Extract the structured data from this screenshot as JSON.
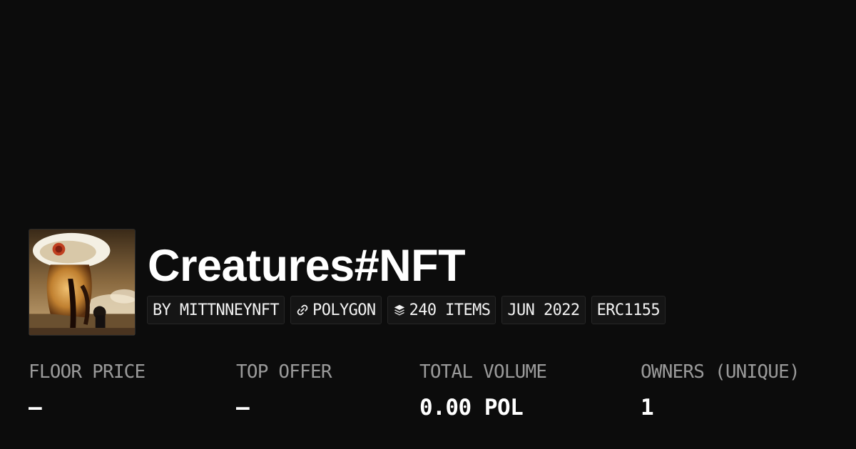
{
  "collection": {
    "name": "Creatures#NFT"
  },
  "tags": {
    "creator": "BY MITTNNEYNFT",
    "chain": "POLYGON",
    "chain_icon": "link-icon",
    "items": "240 ITEMS",
    "items_icon": "layers-icon",
    "date": "JUN 2022",
    "standard": "ERC1155"
  },
  "stats": [
    {
      "label": "FLOOR PRICE",
      "value": "—"
    },
    {
      "label": "TOP OFFER",
      "value": "—"
    },
    {
      "label": "TOTAL VOLUME",
      "value": "0.00 POL"
    },
    {
      "label": "OWNERS (UNIQUE)",
      "value": "1"
    }
  ],
  "colors": {
    "background": "#0c0c0c",
    "text": "#ffffff",
    "muted": "#9a9a9a",
    "tag_bg": "#151515"
  }
}
